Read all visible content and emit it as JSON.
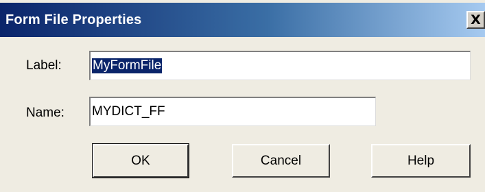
{
  "window": {
    "title": "Form File Properties",
    "close_glyph": "X"
  },
  "form": {
    "label_caption": "Label:",
    "label_value": "MyFormFile",
    "name_caption": "Name:",
    "name_value": "MYDICT_FF"
  },
  "buttons": {
    "ok_label": "OK",
    "cancel_label": "Cancel",
    "help_label": "Help"
  },
  "colors": {
    "titlebar_start": "#0a246a",
    "titlebar_end": "#a6caf0",
    "selection": "#0a246a",
    "dialog_bg": "#efece2"
  }
}
